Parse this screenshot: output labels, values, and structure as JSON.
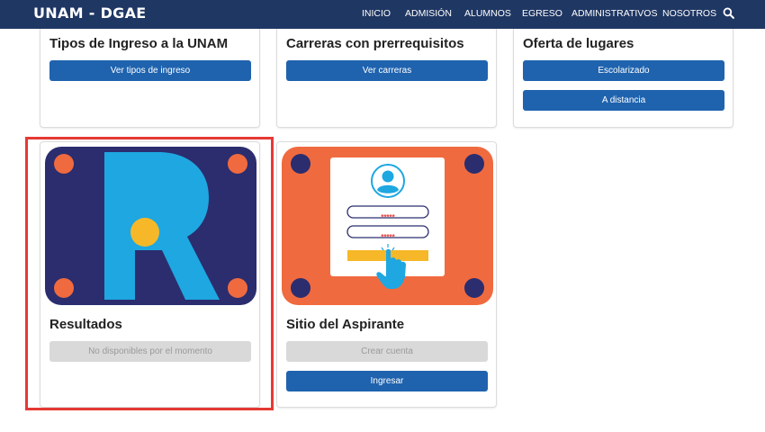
{
  "navbar": {
    "brand": "UNAM - DGAE",
    "items": [
      "INICIO",
      "ADMISIÓN",
      "ALUMNOS",
      "EGRESO",
      "ADMINISTRATIVOS",
      "NOSOTROS"
    ],
    "search_icon": "search-icon",
    "bg_color": "#1f3763"
  },
  "cards": {
    "tipos": {
      "title": "Tipos de Ingreso a la UNAM",
      "button": "Ver tipos de ingreso"
    },
    "carreras": {
      "title": "Carreras con prerrequisitos",
      "button": "Ver carreras"
    },
    "oferta": {
      "title": "Oferta de lugares",
      "buttons": [
        "Escolarizado",
        "A distancia"
      ]
    },
    "resultados": {
      "title": "Resultados",
      "button": "No disponibles por el momento",
      "image_icon": "r-logo-icon"
    },
    "aspirante": {
      "title": "Sitio del Aspirante",
      "buttons": [
        "Crear cuenta",
        "Ingresar"
      ],
      "image_icon": "login-form-icon",
      "masked_fields": [
        "*****",
        "*****"
      ]
    }
  },
  "colors": {
    "primary_button": "#1f63ae",
    "disabled_button": "#d9d9d9",
    "highlight": "#e53935",
    "navy_art": "#2b2d6e",
    "orange_art": "#f06a3f",
    "cyan_art": "#1ea7e1",
    "gold_art": "#f6b828"
  }
}
